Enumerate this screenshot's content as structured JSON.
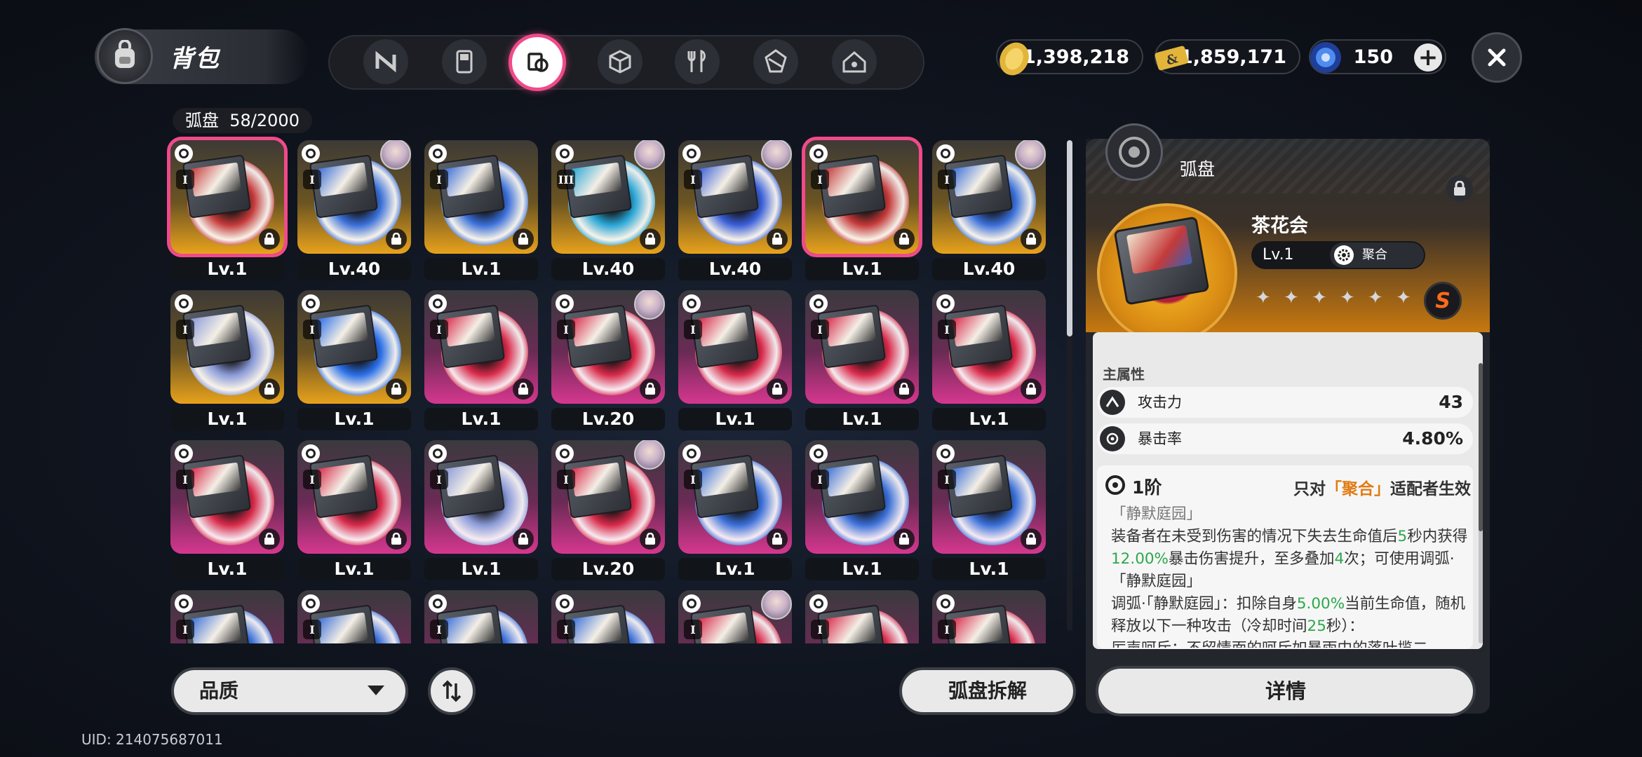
{
  "header": {
    "bag_title": "背包",
    "categories": [
      {
        "icon": "engine-n-icon",
        "active": false
      },
      {
        "icon": "gameboy-icon",
        "active": false
      },
      {
        "icon": "disc-cartridge-icon",
        "active": true
      },
      {
        "icon": "cube-icon",
        "active": false
      },
      {
        "icon": "fork-knife-icon",
        "active": false
      },
      {
        "icon": "drive-module-icon",
        "active": false
      },
      {
        "icon": "house-icon",
        "active": false
      }
    ],
    "currencies": [
      {
        "icon": "gold-coin-icon",
        "value": "1,398,218"
      },
      {
        "icon": "ticket-icon",
        "value": "1,859,171"
      },
      {
        "icon": "crystal-icon",
        "value": "150"
      }
    ]
  },
  "inventory": {
    "title": "弧盘",
    "count": "58/2000",
    "items": [
      {
        "level": "Lv.1",
        "rarity": "gold",
        "rank": "I",
        "selected": true,
        "avatar": false,
        "art": "#c43a3a"
      },
      {
        "level": "Lv.40",
        "rarity": "gold",
        "rank": "I",
        "selected": false,
        "avatar": true,
        "art": "#3a6fd8"
      },
      {
        "level": "Lv.1",
        "rarity": "gold",
        "rank": "I",
        "selected": false,
        "avatar": false,
        "art": "#3a6fd8"
      },
      {
        "level": "Lv.40",
        "rarity": "gold",
        "rank": "III",
        "selected": false,
        "avatar": true,
        "art": "#2aa6d6"
      },
      {
        "level": "Lv.40",
        "rarity": "gold",
        "rank": "I",
        "selected": false,
        "avatar": true,
        "art": "#3a5fd8"
      },
      {
        "level": "Lv.1",
        "rarity": "gold",
        "rank": "I",
        "selected": true,
        "avatar": false,
        "art": "#c43a3a"
      },
      {
        "level": "Lv.40",
        "rarity": "gold",
        "rank": "I",
        "selected": false,
        "avatar": true,
        "art": "#3a6fd8"
      },
      {
        "level": "Lv.1",
        "rarity": "gold",
        "rank": "I",
        "selected": false,
        "avatar": false,
        "art": "#8a9ad8"
      },
      {
        "level": "Lv.1",
        "rarity": "gold",
        "rank": "I",
        "selected": false,
        "avatar": false,
        "art": "#2a6fe8"
      },
      {
        "level": "Lv.1",
        "rarity": "pink",
        "rank": "I",
        "selected": false,
        "avatar": false,
        "art": "#d82a4a"
      },
      {
        "level": "Lv.20",
        "rarity": "pink",
        "rank": "I",
        "selected": false,
        "avatar": true,
        "art": "#d82a4a"
      },
      {
        "level": "Lv.1",
        "rarity": "pink",
        "rank": "I",
        "selected": false,
        "avatar": false,
        "art": "#d82a4a"
      },
      {
        "level": "Lv.1",
        "rarity": "pink",
        "rank": "I",
        "selected": false,
        "avatar": false,
        "art": "#d82a4a"
      },
      {
        "level": "Lv.1",
        "rarity": "pink",
        "rank": "I",
        "selected": false,
        "avatar": false,
        "art": "#d82a4a"
      },
      {
        "level": "Lv.1",
        "rarity": "pink",
        "rank": "I",
        "selected": false,
        "avatar": false,
        "art": "#d82a4a"
      },
      {
        "level": "Lv.1",
        "rarity": "pink",
        "rank": "I",
        "selected": false,
        "avatar": false,
        "art": "#d82a4a"
      },
      {
        "level": "Lv.1",
        "rarity": "pink",
        "rank": "I",
        "selected": false,
        "avatar": false,
        "art": "#8a9ad8"
      },
      {
        "level": "Lv.20",
        "rarity": "pink",
        "rank": "I",
        "selected": false,
        "avatar": true,
        "art": "#d82a4a"
      },
      {
        "level": "Lv.1",
        "rarity": "pink",
        "rank": "I",
        "selected": false,
        "avatar": false,
        "art": "#3a6fd8"
      },
      {
        "level": "Lv.1",
        "rarity": "pink",
        "rank": "I",
        "selected": false,
        "avatar": false,
        "art": "#3a6fd8"
      },
      {
        "level": "Lv.1",
        "rarity": "pink",
        "rank": "I",
        "selected": false,
        "avatar": false,
        "art": "#3a6fd8"
      },
      {
        "level": "",
        "rarity": "pink",
        "rank": "I",
        "selected": false,
        "avatar": false,
        "art": "#3a6fd8"
      },
      {
        "level": "",
        "rarity": "pink",
        "rank": "I",
        "selected": false,
        "avatar": false,
        "art": "#3a6fd8"
      },
      {
        "level": "",
        "rarity": "pink",
        "rank": "I",
        "selected": false,
        "avatar": false,
        "art": "#3a6fd8"
      },
      {
        "level": "",
        "rarity": "pink",
        "rank": "I",
        "selected": false,
        "avatar": false,
        "art": "#3a6fd8"
      },
      {
        "level": "",
        "rarity": "pink",
        "rank": "I",
        "selected": false,
        "avatar": true,
        "art": "#d82a4a"
      },
      {
        "level": "",
        "rarity": "pink",
        "rank": "I",
        "selected": false,
        "avatar": false,
        "art": "#d82a4a"
      },
      {
        "level": "",
        "rarity": "pink",
        "rank": "I",
        "selected": false,
        "avatar": false,
        "art": "#d82a4a"
      }
    ]
  },
  "detail": {
    "panel_title": "弧盘",
    "name": "茶花会",
    "level": "Lv.1",
    "element": "聚合",
    "stars": 6,
    "rank_badge": "S",
    "main_attr_heading": "主属性",
    "stats": [
      {
        "name": "攻击力",
        "value": "43",
        "icon": "attack-icon"
      },
      {
        "name": "暴击率",
        "value": "4.80%",
        "icon": "crit-icon"
      }
    ],
    "tier": "1阶",
    "target_prefix": "只对",
    "target_highlight": "「聚合」",
    "target_suffix": "适配者生效",
    "effect_name": "「静默庭园」",
    "effect_1a": "装备者在未受到伤害的情况下失去生命值后",
    "effect_1b": "5",
    "effect_1c": "秒内获得",
    "effect_1d": "12.00%",
    "effect_1e": "暴击伤害提升，至多叠加",
    "effect_1f": "4",
    "effect_1g": "次；可使用调弧·「静默庭园」",
    "effect_2a": "调弧·「静默庭园」：扣除自身",
    "effect_2b": "5.00%",
    "effect_2c": "当前生命值，随机释放以下一种攻击（冷却时间",
    "effect_2d": "25",
    "effect_2e": "秒）：",
    "effect_3": "厉声呵斥：不留情面的呵斥如暴雨中的落叶揽二"
  },
  "footer": {
    "sort_label": "品质",
    "dismantle_label": "弧盘拆解",
    "detail_label": "详情",
    "uid": "UID: 214075687011"
  },
  "colors": {
    "accent_pink": "#f04a8a",
    "gold_rarity": "#e8a21c",
    "pink_rarity": "#d6378f",
    "highlight_green": "#2ca84a",
    "highlight_orange": "#e07b12"
  }
}
